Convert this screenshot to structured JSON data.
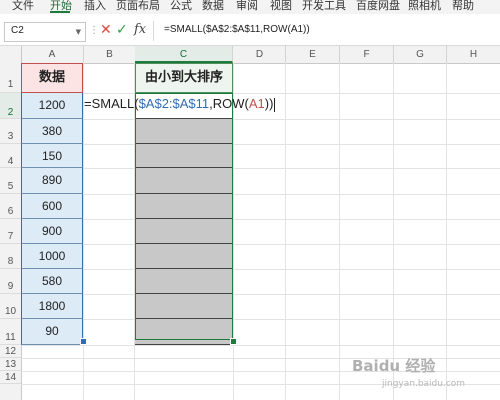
{
  "menubar": {
    "items": [
      "文件",
      "开始",
      "插入",
      "页面布局",
      "公式",
      "数据",
      "审阅",
      "视图",
      "开发工具",
      "百度网盘",
      "照相机",
      "帮助"
    ],
    "active_index": 1,
    "accent_color": "#1f7a3e"
  },
  "formula_bar": {
    "name_box": "C2",
    "fx_label": "fx",
    "formula": "=SMALL($A$2:$A$11,ROW(A1))"
  },
  "columns": [
    "A",
    "B",
    "C",
    "D",
    "E",
    "F",
    "G",
    "H"
  ],
  "selected_column": "C",
  "rows": [
    "1",
    "2",
    "3",
    "4",
    "5",
    "6",
    "7",
    "8",
    "9",
    "10",
    "11",
    "12",
    "13",
    "14"
  ],
  "selected_row": "2",
  "sheet": {
    "a_header": "数据",
    "c_header": "由小到大排序",
    "a_values": [
      "1200",
      "380",
      "150",
      "890",
      "600",
      "900",
      "1000",
      "580",
      "1800",
      "90"
    ],
    "c_cells_count": 10,
    "cell_edit": {
      "prefix": "=SMALL(",
      "range_ref": "$A$2:$A$11",
      "mid": ",ROW(",
      "row_ref": "A1",
      "suffix": "))"
    }
  },
  "watermark": {
    "logo": "Baidu 经验",
    "sub": "jingyan.baidu.com"
  }
}
